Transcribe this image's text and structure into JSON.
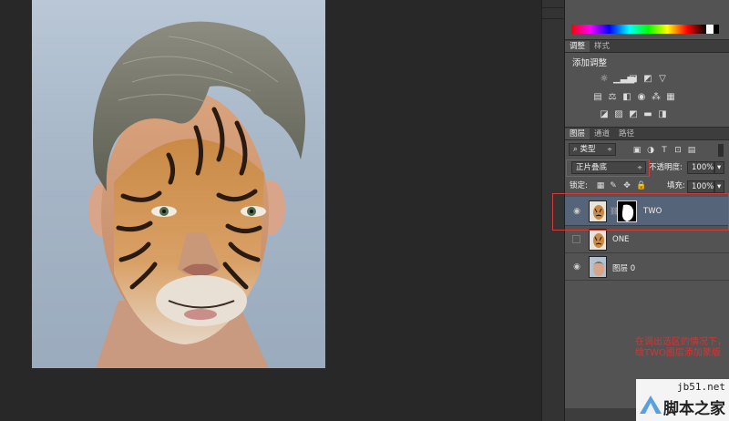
{
  "colors": {
    "canvas_bg": "#282828",
    "panel_bg": "#535353",
    "selected_layer": "#56647a",
    "annotation_red": "#e03030"
  },
  "adjust_panel": {
    "tabs": [
      "调整",
      "样式"
    ],
    "title": "添加调整"
  },
  "layers_panel": {
    "tabs": [
      "图层",
      "通道",
      "路径"
    ],
    "filter_kind": "类型",
    "blend_mode": "正片叠底",
    "opacity_label": "不透明度:",
    "opacity_value": "100%",
    "lock_label": "锁定:",
    "fill_label": "填充:",
    "fill_value": "100%",
    "layers": [
      {
        "name": "TWO",
        "visible": true,
        "has_mask": true,
        "selected": true
      },
      {
        "name": "ONE",
        "visible": false,
        "has_mask": false,
        "selected": false
      },
      {
        "name": "图层 0",
        "visible": true,
        "has_mask": false,
        "selected": false
      }
    ]
  },
  "annotation": {
    "text": "在调出选区的情况下，给TWO图层添加蒙版"
  },
  "watermark": {
    "url": "jb51.net",
    "title": "脚本之家"
  }
}
